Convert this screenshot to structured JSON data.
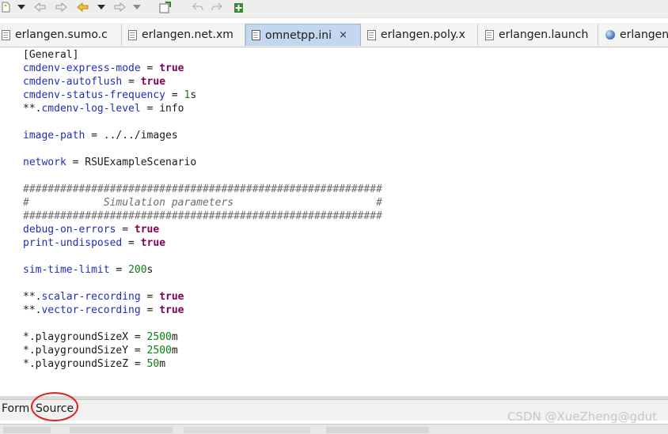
{
  "toolbar": {
    "icons": [
      "new-icon",
      "dropdown-icon",
      "back-icon",
      "forward-icon",
      "prev-edit-icon",
      "dropdown-icon",
      "next-edit-icon",
      "dropdown-icon",
      "toggle-icon",
      "undo-icon",
      "redo-icon",
      "add-icon"
    ]
  },
  "tabs": [
    {
      "label": "erlangen.sumo.c",
      "icon": "file-icon"
    },
    {
      "label": "erlangen.net.xm",
      "icon": "file-icon"
    },
    {
      "label": "omnetpp.ini",
      "icon": "ini-file-icon",
      "close": "×"
    },
    {
      "label": "erlangen.poly.x",
      "icon": "file-icon"
    },
    {
      "label": "erlangen.launch",
      "icon": "file-icon"
    },
    {
      "label": "erlangen.",
      "icon": "globe-icon"
    }
  ],
  "editor": {
    "lines": [
      "[General]",
      "cmdenv-express-mode = true",
      "cmdenv-autoflush = true",
      "cmdenv-status-frequency = 1s",
      "**.cmdenv-log-level = info",
      "",
      "image-path = ../../images",
      "",
      "network = RSUExampleScenario",
      "",
      "##########################################################",
      "#            Simulation parameters                       #",
      "##########################################################",
      "debug-on-errors = true",
      "print-undisposed = true",
      "",
      "sim-time-limit = 200s",
      "",
      "**.scalar-recording = true",
      "**.vector-recording = true",
      "",
      "*.playgroundSizeX = 2500m",
      "*.playgroundSizeY = 2500m",
      "*.playgroundSizeZ = 50m"
    ]
  },
  "pages": {
    "form_label": "Form",
    "source_label": "Source"
  },
  "watermark": "CSDN @XueZheng@gdut",
  "annotation_color": "#e02020"
}
